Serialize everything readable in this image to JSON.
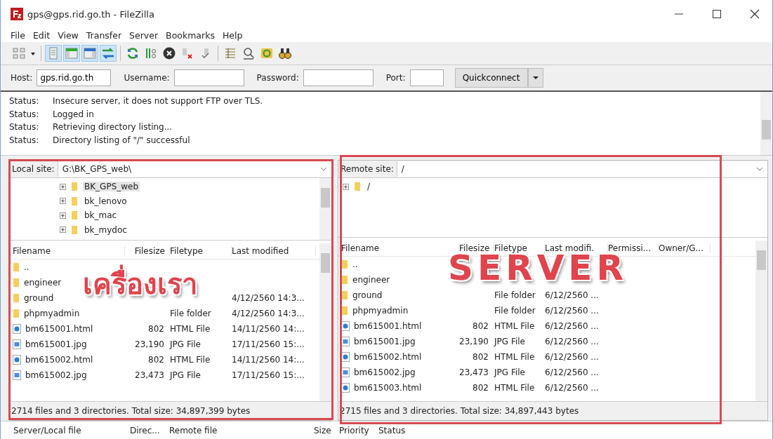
{
  "window": {
    "title": "gps@gps.rid.go.th - FileZilla"
  },
  "menu": [
    "File",
    "Edit",
    "View",
    "Transfer",
    "Server",
    "Bookmarks",
    "Help"
  ],
  "toolbar": [
    {
      "kind": "site-manager",
      "on": false
    },
    {
      "kind": "caret",
      "on": false
    },
    {
      "kind": "log",
      "on": true
    },
    {
      "kind": "local-tree",
      "on": true
    },
    {
      "kind": "remote-tree",
      "on": true
    },
    {
      "kind": "queue",
      "on": true
    },
    {
      "kind": "refresh",
      "on": false
    },
    {
      "kind": "process-queue",
      "on": false
    },
    {
      "kind": "cancel",
      "on": false
    },
    {
      "kind": "disconnect",
      "on": false
    },
    {
      "kind": "reconnect",
      "on": false
    },
    {
      "kind": "filter",
      "on": false
    },
    {
      "kind": "compare",
      "on": false
    },
    {
      "kind": "sync",
      "on": false
    },
    {
      "kind": "search",
      "on": false
    }
  ],
  "quickconnect": {
    "host_label": "Host:",
    "host": "gps.rid.go.th",
    "username_label": "Username:",
    "password_label": "Password:",
    "port_label": "Port:",
    "button": "Quickconnect"
  },
  "log": [
    {
      "label": "Status:",
      "text": "Insecure server, it does not support FTP over TLS."
    },
    {
      "label": "Status:",
      "text": "Logged in"
    },
    {
      "label": "Status:",
      "text": "Retrieving directory listing..."
    },
    {
      "label": "Status:",
      "text": "Directory listing of \"/\" successful"
    }
  ],
  "local": {
    "site_label": "Local site:",
    "path": "G:\\BK_GPS_web\\",
    "tree": [
      {
        "name": "BK_GPS_web",
        "selected": true
      },
      {
        "name": "bk_lenovo",
        "selected": false
      },
      {
        "name": "bk_mac",
        "selected": false
      },
      {
        "name": "bk_mydoc",
        "selected": false
      }
    ],
    "columns": [
      "Filename",
      "Filesize",
      "Filetype",
      "Last modified"
    ],
    "rows": [
      {
        "kind": "folder",
        "name": ".."
      },
      {
        "kind": "folder",
        "name": "engineer"
      },
      {
        "kind": "folder",
        "name": "ground",
        "modified": "4/12/2560 14:3..."
      },
      {
        "kind": "folder",
        "name": "phpmyadmin",
        "type": "File folder",
        "modified": "4/12/2560 14:3..."
      },
      {
        "kind": "html",
        "name": "bm615001.html",
        "size": "802",
        "type": "HTML File",
        "modified": "14/11/2560 14:..."
      },
      {
        "kind": "jpg",
        "name": "bm615001.jpg",
        "size": "23,190",
        "type": "JPG File",
        "modified": "17/11/2560 15:..."
      },
      {
        "kind": "html",
        "name": "bm615002.html",
        "size": "802",
        "type": "HTML File",
        "modified": "14/11/2560 14:..."
      },
      {
        "kind": "jpg",
        "name": "bm615002.jpg",
        "size": "23,473",
        "type": "JPG File",
        "modified": "17/11/2560 15:..."
      }
    ],
    "status": "2714 files and 3 directories. Total size: 34,897,399 bytes",
    "annotation": "เครื่องเรา"
  },
  "remote": {
    "site_label": "Remote site:",
    "path": "/",
    "tree": [
      {
        "name": "/",
        "selected": false
      }
    ],
    "columns": [
      "Filename",
      "Filesize",
      "Filetype",
      "Last modifi.",
      "Permissi...",
      "Owner/G..."
    ],
    "rows": [
      {
        "kind": "folder",
        "name": ".."
      },
      {
        "kind": "folder",
        "name": "engineer"
      },
      {
        "kind": "folder",
        "name": "ground",
        "type": "File folder",
        "modified": "6/12/2560 ..."
      },
      {
        "kind": "folder",
        "name": "phpmyadmin",
        "type": "File folder",
        "modified": "6/12/2560 ..."
      },
      {
        "kind": "html",
        "name": "bm615001.html",
        "size": "802",
        "type": "HTML File",
        "modified": "6/12/2560 ..."
      },
      {
        "kind": "jpg",
        "name": "bm615001.jpg",
        "size": "23,190",
        "type": "JPG File",
        "modified": "6/12/2560 ..."
      },
      {
        "kind": "html",
        "name": "bm615002.html",
        "size": "802",
        "type": "HTML File",
        "modified": "6/12/2560 ..."
      },
      {
        "kind": "jpg",
        "name": "bm615002.jpg",
        "size": "23,473",
        "type": "JPG File",
        "modified": "6/12/2560 ..."
      },
      {
        "kind": "html",
        "name": "bm615003.html",
        "size": "802",
        "type": "HTML File",
        "modified": "6/12/2560 ..."
      }
    ],
    "status": "2715 files and 3 directories. Total size: 34,897,443 bytes",
    "annotation": "SERVER"
  },
  "queue": {
    "columns": [
      "Server/Local file",
      "Direc...",
      "Remote file",
      "Size",
      "Priority",
      "Status"
    ]
  }
}
